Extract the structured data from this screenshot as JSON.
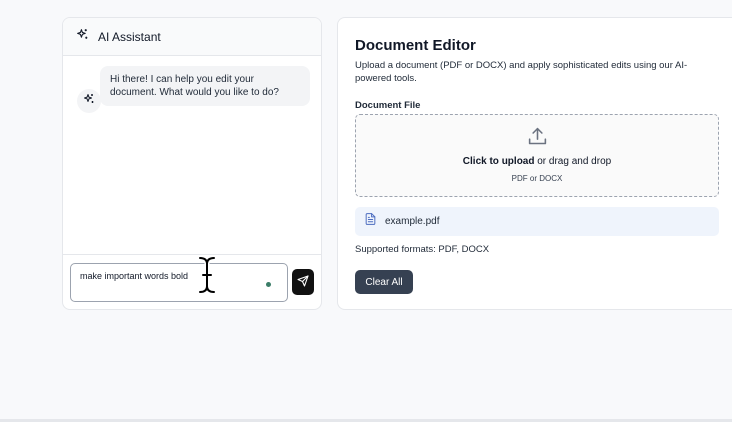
{
  "chat": {
    "title": "AI Assistant",
    "messages": [
      {
        "role": "assistant",
        "text": "Hi there! I can help you edit your document. What would you like to do?"
      }
    ],
    "input": {
      "value": "make important words bold"
    },
    "icons": {
      "assistant": "sparkles-icon",
      "send": "send-icon",
      "cursor": "text-cursor-icon"
    }
  },
  "editor": {
    "title": "Document Editor",
    "description": "Upload a document (PDF or DOCX) and apply sophisticated edits using our AI-powered tools.",
    "file_label": "Document File",
    "dropzone": {
      "click_text": "Click to upload",
      "drag_text": " or drag and drop",
      "subtext": "PDF or DOCX",
      "icon": "upload-icon"
    },
    "file": {
      "name": "example.pdf",
      "icon": "file-icon"
    },
    "supported": "Supported formats: PDF, DOCX",
    "clear_label": "Clear All"
  },
  "colors": {
    "background": "#f8f9fb",
    "send_button": "#111111",
    "clear_button": "#364152",
    "file_row": "#eff4fc",
    "typing_dot": "#3b7d68"
  }
}
